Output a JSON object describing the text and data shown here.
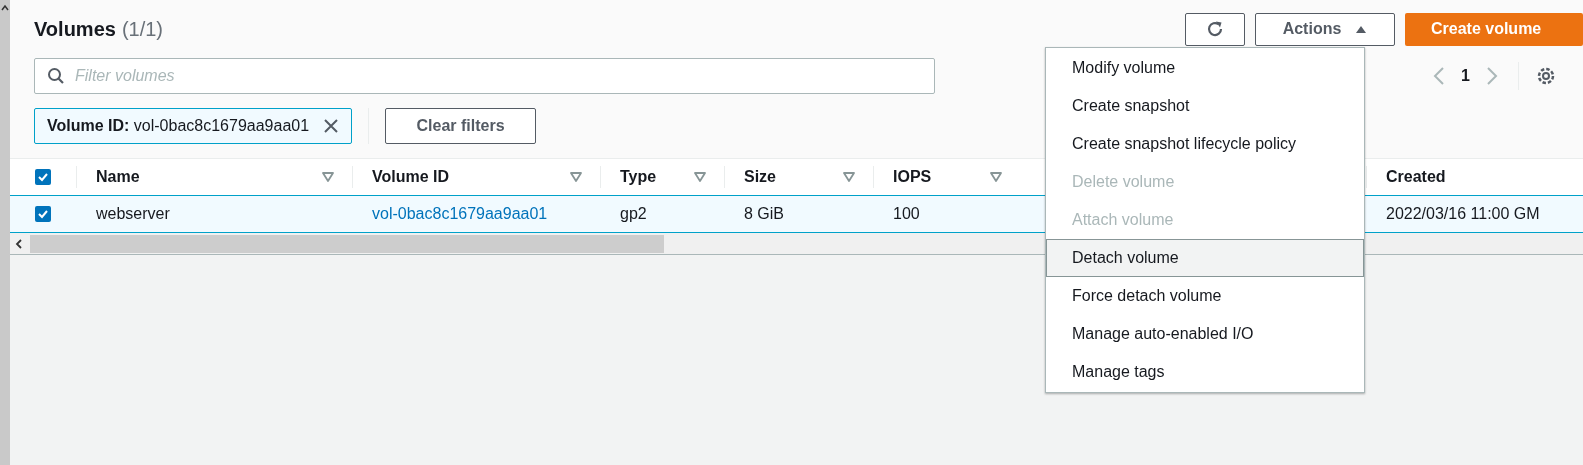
{
  "header": {
    "title": "Volumes",
    "count": "(1/1)"
  },
  "toolbar": {
    "actions": {
      "label": "Actions",
      "expanded": true
    },
    "create": "Create volume"
  },
  "filter": {
    "placeholder": "Filter volumes",
    "token": "**Volume ID:** vol-0bac8c1679aa9aa01",
    "clear": "Clear filters"
  },
  "pagination": {
    "page": "1"
  },
  "table": {
    "all_checked": true,
    "columns": [
      {
        "label": "Name",
        "sortable": true
      },
      {
        "label": "Volume ID",
        "sortable": true
      },
      {
        "label": "Type",
        "sortable": true
      },
      {
        "label": "Size",
        "sortable": true
      },
      {
        "label": "IOPS",
        "sortable": true
      },
      {
        "label": "Created",
        "sortable": false
      }
    ],
    "rows": [
      {
        "selected": true,
        "checked": true,
        "cells": [
          {
            "text": "webserver",
            "kind": "text"
          },
          {
            "text": "vol-0bac8c1679aa9aa01",
            "kind": "link"
          },
          {
            "text": "gp2",
            "kind": "text"
          },
          {
            "text": "8 GiB",
            "kind": "text"
          },
          {
            "text": "100",
            "kind": "text"
          },
          {
            "text": "2022/03/16 11:00 GM",
            "kind": "text"
          }
        ]
      }
    ]
  },
  "menu": [
    {
      "label": "Modify volume",
      "disabled": false,
      "selected": false
    },
    {
      "label": "Create snapshot",
      "disabled": false,
      "selected": false
    },
    {
      "label": "Create snapshot lifecycle policy",
      "disabled": false,
      "selected": false
    },
    {
      "label": "Delete volume",
      "disabled": true,
      "selected": false
    },
    {
      "label": "Attach volume",
      "disabled": true,
      "selected": false
    },
    {
      "label": "Detach volume",
      "disabled": false,
      "selected": true
    },
    {
      "label": "Force detach volume",
      "disabled": false,
      "selected": false
    },
    {
      "label": "Manage auto-enabled I/O",
      "disabled": false,
      "selected": false
    },
    {
      "label": "Manage tags",
      "disabled": false,
      "selected": false
    }
  ]
}
